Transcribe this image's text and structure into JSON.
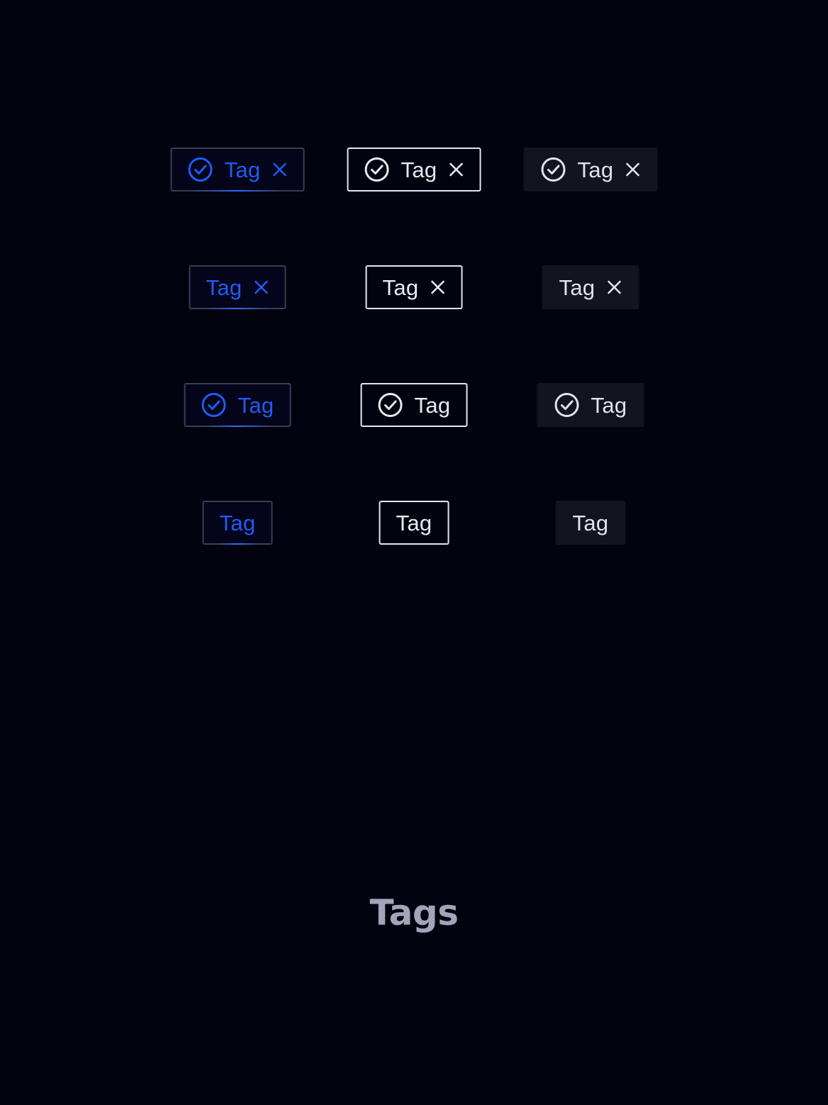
{
  "page": {
    "title": "Tags"
  },
  "colors": {
    "background": "#03030f",
    "primary": "#1f5cf5",
    "outline": "#e8e8ee",
    "filled_bg": "#14141f",
    "title": "#a4a3b9"
  },
  "tags": {
    "row1": {
      "primary": {
        "label": "Tag",
        "leading_icon": "check-circle-icon",
        "trailing_icon": "close-icon"
      },
      "outline": {
        "label": "Tag",
        "leading_icon": "check-circle-icon",
        "trailing_icon": "close-icon"
      },
      "filled": {
        "label": "Tag",
        "leading_icon": "check-circle-icon",
        "trailing_icon": "close-icon"
      }
    },
    "row2": {
      "primary": {
        "label": "Tag",
        "trailing_icon": "close-icon"
      },
      "outline": {
        "label": "Tag",
        "trailing_icon": "close-icon"
      },
      "filled": {
        "label": "Tag",
        "trailing_icon": "close-icon"
      }
    },
    "row3": {
      "primary": {
        "label": "Tag",
        "leading_icon": "check-circle-icon"
      },
      "outline": {
        "label": "Tag",
        "leading_icon": "check-circle-icon"
      },
      "filled": {
        "label": "Tag",
        "leading_icon": "check-circle-icon"
      }
    },
    "row4": {
      "primary": {
        "label": "Tag"
      },
      "outline": {
        "label": "Tag"
      },
      "filled": {
        "label": "Tag"
      }
    }
  }
}
